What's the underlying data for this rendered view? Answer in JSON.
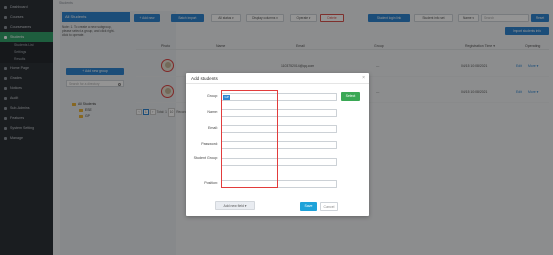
{
  "breadcrumb": "Students",
  "sidebar": {
    "items": [
      {
        "label": "Dashboard",
        "icon": "dashboard-icon"
      },
      {
        "label": "Courses",
        "icon": "courses-icon"
      },
      {
        "label": "Coursewares",
        "icon": "courseware-icon"
      },
      {
        "label": "Students",
        "icon": "students-icon"
      },
      {
        "label": "Home Page",
        "icon": "home-icon"
      },
      {
        "label": "Grades",
        "icon": "grades-icon"
      },
      {
        "label": "Notices",
        "icon": "notices-icon"
      },
      {
        "label": "Audit",
        "icon": "audit-icon"
      },
      {
        "label": "Sub-Admins",
        "icon": "sub-admins-icon"
      },
      {
        "label": "Features",
        "icon": "features-icon"
      },
      {
        "label": "System Setting",
        "icon": "system-setting-icon"
      },
      {
        "label": "Manage",
        "icon": "manage-icon"
      }
    ],
    "subitems": [
      "Students List",
      "Settings",
      "Results"
    ]
  },
  "left_panel": {
    "header": "All Students",
    "note": "Note: 1. To create a new subgroup, please select a group, and click right-click to operate.",
    "add_group": "+ Add new group",
    "search_placeholder": "Search for a directory",
    "tree": {
      "root": "All Students",
      "children": [
        "ESE",
        "GP"
      ]
    }
  },
  "toolbar": {
    "add_new": "+ Add new",
    "batch_import": "Batch import",
    "all_status": "All status ▾",
    "display_columns": "Display columns ▾",
    "operate": "Operate ▾",
    "delete": "Delete",
    "student_login_link": "Student login link",
    "student_info_set": "Student info set",
    "search_field": "Name ▾",
    "search_placeholder": "Search",
    "reset": "Reset",
    "import_info": "Import students info"
  },
  "table": {
    "headers": [
      "Photo",
      "Name",
      "Email",
      "Group",
      "Registration Time ▾",
      "Operating"
    ],
    "rows": [
      {
        "name": "",
        "email": "1103752014@qq.com",
        "group": "---",
        "time": "04/15 10:08/2021",
        "edit": "Edit",
        "more": "More ▾"
      },
      {
        "name": "",
        "email": "1103752014@qq.com",
        "group": "---",
        "time": "04/15 10:08/2021",
        "edit": "Edit",
        "more": "More ▾"
      }
    ],
    "pager": {
      "page": "1",
      "pages": "Total: 1",
      "per_page": "10",
      "records": "Records: 2 Results"
    }
  },
  "modal": {
    "title": "Add students",
    "close": "×",
    "group_label": "Group:",
    "group_tag": "GP",
    "select_button": "Select",
    "name_label": "Name:",
    "email_label": "Email:",
    "password_label": "Password:",
    "student_group_label": "Student Group:",
    "position_label": "Position:",
    "add_field": "Add new field ▾",
    "save": "Save",
    "cancel": "Cancel"
  },
  "colors": {
    "accent_blue": "#2f86d1",
    "sidebar_bg": "#2d3238",
    "active_green": "#34a36b",
    "select_green": "#3aa855",
    "save_blue": "#1ea2d9",
    "highlight_red": "#e23c3c"
  }
}
